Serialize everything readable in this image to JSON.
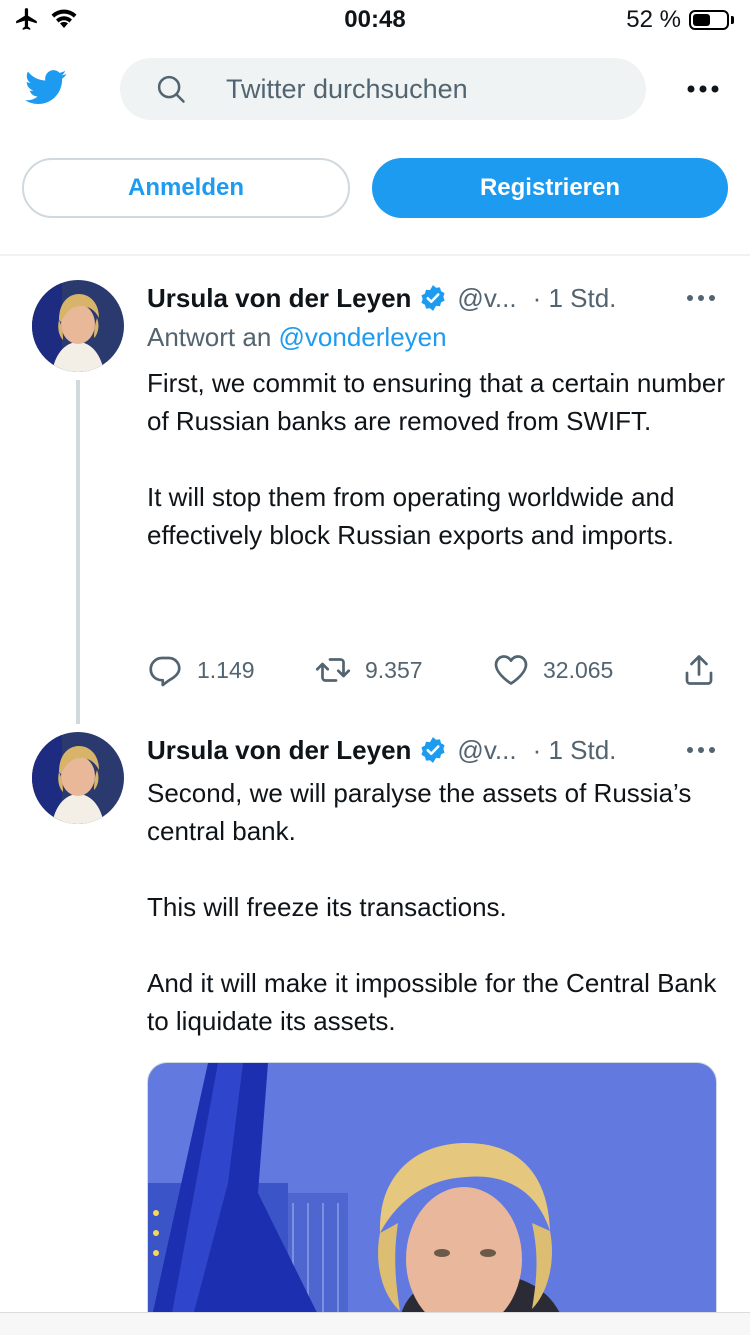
{
  "status_bar": {
    "time": "00:48",
    "battery_percent": "52 %",
    "battery_level": 0.52
  },
  "header": {
    "search": {
      "placeholder": "Twitter durchsuchen"
    }
  },
  "auth": {
    "login_label": "Anmelden",
    "signup_label": "Registrieren"
  },
  "tweets": [
    {
      "author_name": "Ursula von der Leyen",
      "handle": "@v...",
      "time": "· 1 Std.",
      "reply_prefix": "Antwort an",
      "reply_mention": "@vonderleyen",
      "paragraphs": [
        "First, we commit to ensuring that a certain number of Russian banks are removed from SWIFT.",
        "It will stop them from operating worldwide and effectively block Russian exports and imports."
      ],
      "replies": "1.149",
      "retweets": "9.357",
      "likes": "32.065"
    },
    {
      "author_name": "Ursula von der Leyen",
      "handle": "@v...",
      "time": "· 1 Std.",
      "paragraphs": [
        "Second, we will paralyse the assets of Russia’s central bank.",
        "This will freeze its transactions.",
        "And it will make it impossible for the Central Bank to liquidate its assets."
      ]
    }
  ],
  "colors": {
    "accent": "#1d9bf0",
    "text": "#0f1419",
    "muted": "#536471",
    "border": "#cfd9de"
  },
  "icons": [
    "airplane-icon",
    "wifi-icon",
    "battery-icon",
    "twitter-bird-icon",
    "search-icon",
    "more-icon",
    "verified-badge-icon",
    "reply-icon",
    "retweet-icon",
    "like-icon",
    "share-icon"
  ]
}
